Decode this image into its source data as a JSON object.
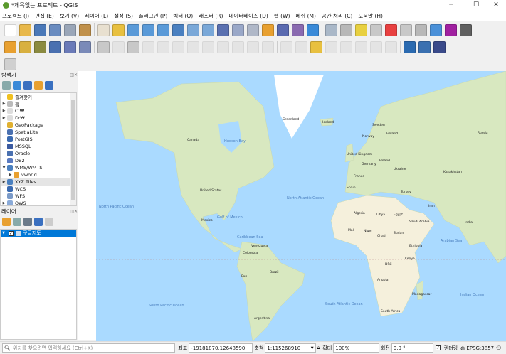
{
  "window": {
    "title": "*제목없는 프로젝트 - QGIS",
    "minimize": "─",
    "maximize": "☐",
    "close": "✕"
  },
  "menu": [
    "프로젝트 (J)",
    "편집 (E)",
    "보기 (V)",
    "레이어 (L)",
    "설정 (S)",
    "플러그인 (P)",
    "벡터 (O)",
    "래스터 (R)",
    "데이터베이스 (D)",
    "웹 (W)",
    "메쉬 (M)",
    "공간 처리 (C)",
    "도움말 (H)"
  ],
  "toolbar1": [
    {
      "icon": "new-project-icon",
      "color": "#ffffff"
    },
    {
      "icon": "open-project-icon",
      "color": "#e8b84a"
    },
    {
      "icon": "save-project-icon",
      "color": "#4a78b8"
    },
    {
      "icon": "save-as-icon",
      "color": "#6a8cc0"
    },
    {
      "icon": "print-layout-icon",
      "color": "#9aa6b8"
    },
    {
      "icon": "style-manager-icon",
      "color": "#c0904a"
    },
    {
      "icon": "pan-icon",
      "color": "#e8e0d0"
    },
    {
      "icon": "pan-to-selection-icon",
      "color": "#e8c040"
    },
    {
      "icon": "zoom-in-icon",
      "color": "#5a9ad8"
    },
    {
      "icon": "zoom-out-icon",
      "color": "#5a9ad8"
    },
    {
      "icon": "zoom-native-icon",
      "color": "#5a9ad8"
    },
    {
      "icon": "zoom-full-icon",
      "color": "#4a80c0"
    },
    {
      "icon": "zoom-selection-icon",
      "color": "#7aa8d8"
    },
    {
      "icon": "zoom-layer-icon",
      "color": "#7aa8d8"
    },
    {
      "icon": "zoom-last-icon",
      "color": "#5a70b0"
    },
    {
      "icon": "zoom-next-icon",
      "color": "#9aa8c8"
    },
    {
      "icon": "new-map-view-icon",
      "color": "#b0b8c8"
    },
    {
      "icon": "temporal-icon",
      "color": "#e8a030"
    },
    {
      "icon": "bookmark-icon",
      "color": "#5a6ab0"
    },
    {
      "icon": "show-bookmarks-icon",
      "color": "#8a6ab0"
    },
    {
      "icon": "refresh-icon",
      "color": "#3a8ad8"
    },
    {
      "icon": "identify-icon",
      "color": "#aab8c8"
    },
    {
      "icon": "measure-icon",
      "color": "#b8b8b8"
    },
    {
      "icon": "select-icon",
      "color": "#e8d040"
    },
    {
      "icon": "select-value-icon",
      "color": "#c8c8c8"
    },
    {
      "icon": "deselect-icon",
      "color": "#e84040"
    },
    {
      "icon": "attribute-table-icon",
      "color": "#c8c8c8"
    },
    {
      "icon": "field-calculator-icon",
      "color": "#b8b8b8"
    },
    {
      "icon": "settings-gear-icon",
      "color": "#4a90d8"
    },
    {
      "icon": "statistics-sigma-icon",
      "color": "#a020a0"
    },
    {
      "icon": "ruler-icon",
      "color": "#606060"
    }
  ],
  "toolbar2": [
    {
      "icon": "data-source-manager-icon",
      "color": "#e8a030"
    },
    {
      "icon": "new-geopackage-icon",
      "color": "#d8b040"
    },
    {
      "icon": "new-shapefile-icon",
      "color": "#8a8a40"
    },
    {
      "icon": "new-spatialite-icon",
      "color": "#4a70b0"
    },
    {
      "icon": "new-temp-layer-icon",
      "color": "#6a7ab8"
    },
    {
      "icon": "new-virtual-layer-icon",
      "color": "#7a8ab8"
    },
    {
      "icon": "digitize-icon",
      "color": "#c8c8c8"
    },
    {
      "icon": "edit-pencil-icon",
      "color": "#d0d0d0"
    },
    {
      "icon": "save-edits-icon",
      "color": "#c8c8c8"
    },
    {
      "icon": "add-feature-icon",
      "color": "#d0d0d0"
    },
    {
      "icon": "vertex-tool-icon",
      "color": "#d0d0d0"
    },
    {
      "icon": "modify-attributes-icon",
      "color": "#d0d0d0"
    },
    {
      "icon": "delete-icon",
      "color": "#d0d0d0"
    },
    {
      "icon": "cut-icon",
      "color": "#d0d0d0"
    },
    {
      "icon": "copy-icon",
      "color": "#d0d0d0"
    },
    {
      "icon": "paste-icon",
      "color": "#d0d0d0"
    },
    {
      "icon": "undo-icon",
      "color": "#d0d0d0"
    },
    {
      "icon": "redo-icon",
      "color": "#d0d0d0"
    },
    {
      "icon": "label-icon",
      "color": "#d0d0d0"
    },
    {
      "icon": "label-pin-icon",
      "color": "#d0d0d0"
    },
    {
      "icon": "label-abc-icon",
      "color": "#e8c040"
    },
    {
      "icon": "label-move-icon",
      "color": "#d0d0d0"
    },
    {
      "icon": "label-rotate-icon",
      "color": "#d0d0d0"
    },
    {
      "icon": "label-props-icon",
      "color": "#d0d0d0"
    },
    {
      "icon": "label-show-icon",
      "color": "#d0d0d0"
    },
    {
      "icon": "label-diagram-icon",
      "color": "#d0d0d0"
    },
    {
      "icon": "quickmapservices-icon",
      "color": "#2a6ab0"
    },
    {
      "icon": "python-icon",
      "color": "#3a70b0"
    },
    {
      "icon": "help-icon",
      "color": "#3a4a8a"
    }
  ],
  "toolbar3": [
    {
      "icon": "eraser-icon",
      "color": "#d0d0d0"
    }
  ],
  "browser": {
    "title": "탐색기",
    "tools": [
      {
        "icon": "add-layer-icon",
        "color": "#8aa"
      },
      {
        "icon": "refresh-icon",
        "color": "#3a8ad8"
      },
      {
        "icon": "filter-icon",
        "color": "#3a70c0"
      },
      {
        "icon": "collapse-all-icon",
        "color": "#e8a030"
      },
      {
        "icon": "info-icon",
        "color": "#3a70c0"
      }
    ],
    "items": [
      {
        "label": "즐겨찾기",
        "icon": "star-icon",
        "color": "#f0c020",
        "arrow": ""
      },
      {
        "label": "홈",
        "icon": "home-icon",
        "color": "#bbbbbb",
        "arrow": "▶"
      },
      {
        "label": "C:₩",
        "icon": "folder-icon",
        "color": "#dddddd",
        "arrow": "▶"
      },
      {
        "label": "D:₩",
        "icon": "folder-icon",
        "color": "#dddddd",
        "arrow": "▶"
      },
      {
        "label": "GeoPackage",
        "icon": "geopackage-icon",
        "color": "#e0b030",
        "arrow": ""
      },
      {
        "label": "SpatiaLite",
        "icon": "spatialite-icon",
        "color": "#4a70b0",
        "arrow": ""
      },
      {
        "label": "PostGIS",
        "icon": "postgis-icon",
        "color": "#3a6ab0",
        "arrow": ""
      },
      {
        "label": "MSSQL",
        "icon": "mssql-icon",
        "color": "#3a5aa0",
        "arrow": ""
      },
      {
        "label": "Oracle",
        "icon": "oracle-icon",
        "color": "#4a70b0",
        "arrow": ""
      },
      {
        "label": "DB2",
        "icon": "db2-icon",
        "color": "#5a7ac0",
        "arrow": ""
      },
      {
        "label": "WMS/WMTS",
        "icon": "wms-icon",
        "color": "#4a80c0",
        "arrow": "▼"
      },
      {
        "label": "vworld",
        "icon": "connection-icon",
        "color": "#e8a030",
        "arrow": "▶",
        "indent": true
      },
      {
        "label": "XYZ Tiles",
        "icon": "xyz-tiles-icon",
        "color": "#4a80c0",
        "arrow": "▶",
        "selected": true
      },
      {
        "label": "WCS",
        "icon": "wcs-icon",
        "color": "#3a6ab0",
        "arrow": ""
      },
      {
        "label": "WFS",
        "icon": "wfs-icon",
        "color": "#7a9ac8",
        "arrow": ""
      },
      {
        "label": "OWS",
        "icon": "ows-icon",
        "color": "#8aaad8",
        "arrow": "▶"
      }
    ]
  },
  "layers": {
    "title": "레이어",
    "tools": [
      {
        "icon": "style-icon",
        "color": "#e8a030"
      },
      {
        "icon": "add-group-icon",
        "color": "#8aa"
      },
      {
        "icon": "visibility-icon",
        "color": "#6a7a8a"
      },
      {
        "icon": "filter-legend-icon",
        "color": "#3a70c0"
      },
      {
        "icon": "expression-filter-icon",
        "color": "#cccccc"
      }
    ],
    "items": [
      {
        "label": "구글지도",
        "checked": "✓"
      }
    ]
  },
  "map": {
    "colors": {
      "ocean": "#aadaff",
      "land": "#d8e8c0",
      "desert": "#f5f0dc",
      "ice": "#ffffff"
    },
    "labels": [
      "Greenland",
      "Canada",
      "United States",
      "Mexico",
      "Brazil",
      "Argentina",
      "Peru",
      "Colombia",
      "Venezuela",
      "Russia",
      "Kazakhstan",
      "India",
      "Algeria",
      "Libya",
      "Egypt",
      "Sudan",
      "Chad",
      "Niger",
      "Mali",
      "DRC",
      "Angola",
      "South Africa",
      "Madagascar",
      "Saudi Arabia",
      "Iran",
      "Turkey",
      "France",
      "Spain",
      "Germany",
      "Poland",
      "Ukraine",
      "Sweden",
      "Norway",
      "Finland",
      "Iceland",
      "United Kingdom",
      "Ethiopia",
      "Kenya"
    ],
    "oceans": [
      "North Atlantic Ocean",
      "South Atlantic Ocean",
      "North Pacific Ocean",
      "South Pacific Ocean",
      "Indian Ocean",
      "Hudson Bay",
      "Gulf of Mexico",
      "Caribbean Sea",
      "Arabian Sea"
    ]
  },
  "status": {
    "search_placeholder": "위치를 찾으려면 입력하세요 (Ctrl+K)",
    "coord_label": "좌표",
    "coord_value": "-19181870,12648590",
    "scale_label": "축척",
    "scale_value": "1:115268910",
    "magnifier_label": "확대",
    "magnifier_value": "100%",
    "rotation_label": "회전",
    "rotation_value": "0.0 °",
    "render_label": "렌더링",
    "render_checked": "✓",
    "crs": "EPSG:3857"
  }
}
